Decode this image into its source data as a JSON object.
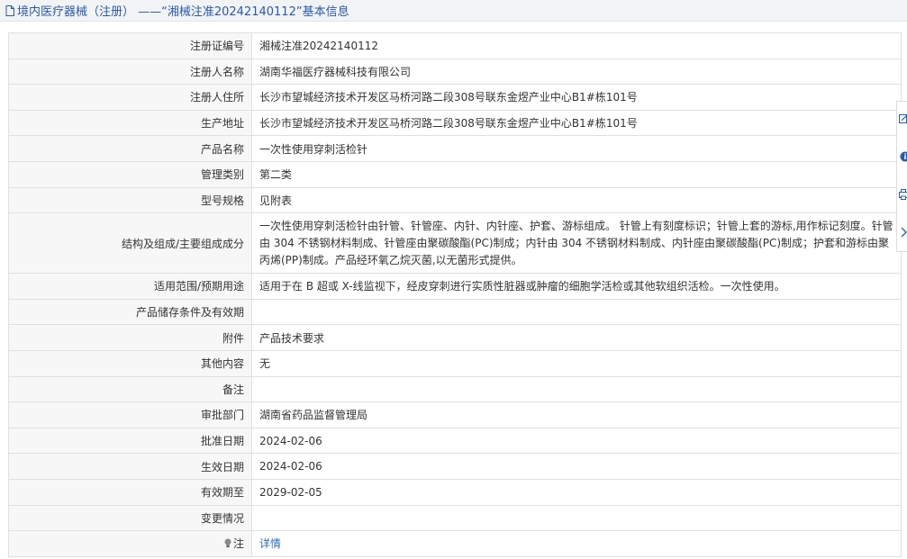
{
  "header": {
    "title": "境内医疗器械（注册） ——“湘械注准20242140112”基本信息",
    "icon": "document-icon"
  },
  "rows": [
    {
      "label": "注册证编号",
      "value": "湘械注准20242140112"
    },
    {
      "label": "注册人名称",
      "value": "湖南华福医疗器械科技有限公司"
    },
    {
      "label": "注册人住所",
      "value": "长沙市望城经济技术开发区马桥河路二段308号联东金煜产业中心B1#栋101号"
    },
    {
      "label": "生产地址",
      "value": "长沙市望城经济技术开发区马桥河路二段308号联东金煜产业中心B1#栋101号"
    },
    {
      "label": "产品名称",
      "value": "一次性使用穿刺活检针"
    },
    {
      "label": "管理类别",
      "value": "第二类"
    },
    {
      "label": "型号规格",
      "value": "见附表"
    },
    {
      "label": "结构及组成/主要组成成分",
      "value": "一次性使用穿刺活检针由针管、针管座、内针、内针座、护套、游标组成。 针管上有刻度标识；针管上套的游标,用作标记刻度。针管由 304 不锈钢材料制成、针管座由聚碳酸酯(PC)制成；内针由 304 不锈钢材料制成、内针座由聚碳酸酯(PC)制成；护套和游标由聚丙烯(PP)制成。产品经环氧乙烷灭菌,以无菌形式提供。"
    },
    {
      "label": "适用范围/预期用途",
      "value": "适用于在 B 超或 X-线监视下，经皮穿刺进行实质性脏器或肿瘤的细胞学活检或其他软组织活检。一次性使用。"
    },
    {
      "label": "产品储存条件及有效期",
      "value": ""
    },
    {
      "label": "附件",
      "value": "产品技术要求"
    },
    {
      "label": "其他内容",
      "value": "无"
    },
    {
      "label": "备注",
      "value": ""
    },
    {
      "label": "审批部门",
      "value": "湖南省药品监督管理局"
    },
    {
      "label": "批准日期",
      "value": "2024-02-06"
    },
    {
      "label": "生效日期",
      "value": "2024-02-06"
    },
    {
      "label": "有效期至",
      "value": "2029-02-05"
    },
    {
      "label": "变更情况",
      "value": ""
    }
  ],
  "note_row": {
    "label": "注",
    "link_text": "详情",
    "icon": "lightbulb-icon"
  },
  "side_tools": [
    "edit-icon",
    "info-icon",
    "print-icon",
    "collapse-arrow-icon"
  ],
  "colors": {
    "accent": "#2a5aa8",
    "link": "#2a6fb8",
    "label_bg": "#f7f7f7",
    "border": "#e0e0e0"
  }
}
